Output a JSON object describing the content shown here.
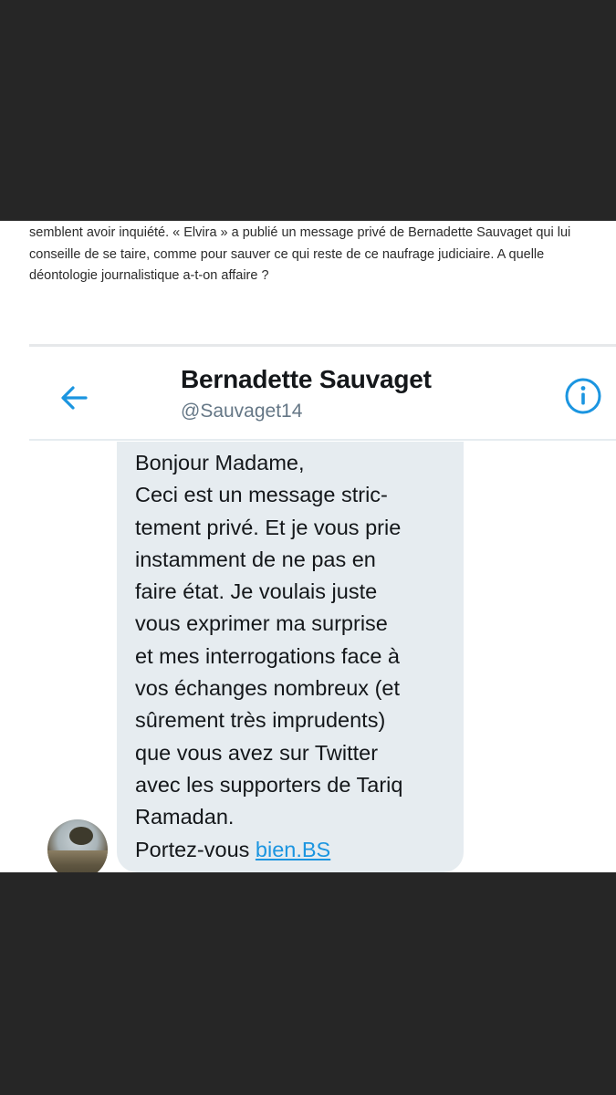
{
  "article": {
    "lines": [
      "semblent avoir inquiété. « Elvira » a publié un message privé de Bernadette Sauvaget qui lui",
      "conseille de se taire, comme pour sauver ce qui reste de ce naufrage judiciaire. A quelle",
      "déontologie journalistique a-t-on affaire ?"
    ]
  },
  "dm": {
    "name": "Bernadette Sauvaget",
    "handle": "@Sauvaget14",
    "back_icon": "arrow-left-icon",
    "info_icon": "info-icon",
    "accent": "#1b95e0",
    "message_lines": [
      "Bonjour Madame,",
      "Ceci est un message stric-",
      "tement privé. Et je vous prie",
      "instamment de ne pas en",
      "faire état. Je voulais juste",
      "vous exprimer ma surprise",
      "et mes interrogations face à",
      "vos échanges nombreux (et",
      "sûrement très imprudents)",
      "que vous avez sur Twitter",
      "avec les supporters de Tariq",
      "Ramadan."
    ],
    "last_line_prefix": "Portez-vous ",
    "last_line_link": "bien.BS"
  }
}
